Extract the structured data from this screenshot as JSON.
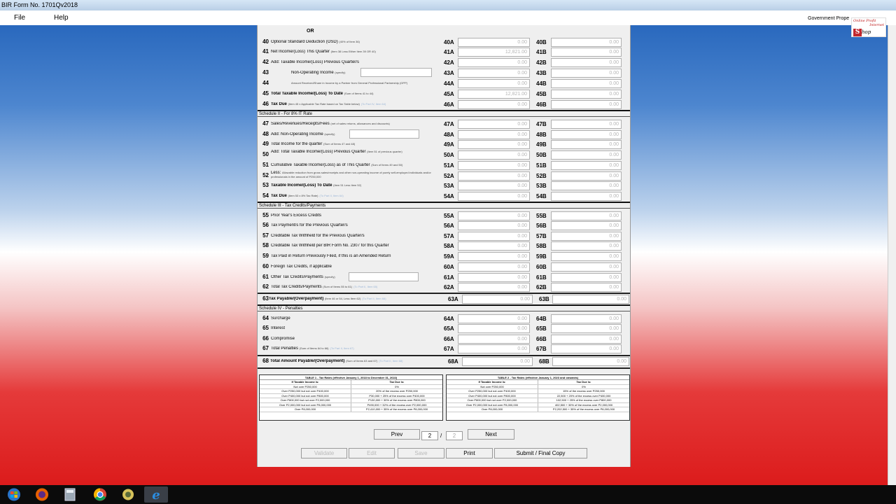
{
  "window": {
    "title": "BIR Form No. 1701Qv2018"
  },
  "menu": {
    "file": "File",
    "help": "Help",
    "gov_label": "Government Prope"
  },
  "logo": {
    "line1": "Online Profit",
    "line2": "Internet",
    "s": "S",
    "shop": "hop"
  },
  "form": {
    "or_label": "OR",
    "rows_top": [
      {
        "num": "40",
        "label": "Optional Standard Deduction (OSD)",
        "sub": "(40% of Item 36)",
        "a": "40A",
        "av": "0.00",
        "b": "40B",
        "bv": "0.00"
      },
      {
        "num": "41",
        "label": "Net Income/(Loss) This Quarter",
        "sub": "(Item 38 Less Either Item 39 OR 40)",
        "a": "41A",
        "av": "12,821.00",
        "b": "41B",
        "bv": "0.00"
      },
      {
        "num": "42",
        "pre": "Add:",
        "label": "Taxable Income/(Loss) Previous Quarter/s",
        "sub": "",
        "a": "42A",
        "av": "0.00",
        "b": "42B",
        "bv": "0.00"
      },
      {
        "num": "43",
        "label": "Non-Operating Income",
        "sub": "(specify)",
        "a": "43A",
        "av": "0.00",
        "b": "43B",
        "bv": "0.00"
      },
      {
        "num": "44",
        "label": "",
        "sub": "Amount Received/Share in Income by a Partner from General Professional Partnership (GPP)",
        "a": "44A",
        "av": "0.00",
        "b": "44B",
        "bv": "0.00"
      },
      {
        "num": "45",
        "label": "Total Taxable Income/(Loss) To Date",
        "sub": "(Sum of Items 41 to 44)",
        "a": "45A",
        "av": "12,821.00",
        "b": "45B",
        "bv": "0.00"
      },
      {
        "num": "46",
        "label": "Tax Due",
        "sub": "(Item 45 x Applicable Tax Rate based on Tax Table below)",
        "hint": "(To Part IV, Item 64)",
        "a": "46A",
        "av": "0.00",
        "b": "46B",
        "bv": "0.00"
      }
    ],
    "schedule2": "Schedule II - For 8% IT Rate",
    "rows_s2": [
      {
        "num": "47",
        "label": "Sales/Revenues/Receipts/Fees",
        "sub": "(net of sales returns, allowances and discounts)",
        "a": "47A",
        "av": "0.00",
        "b": "47B",
        "bv": "0.00"
      },
      {
        "num": "48",
        "label": "Add: Non-Operating Income",
        "sub": "(specify)",
        "a": "48A",
        "av": "0.00",
        "b": "48B",
        "bv": "0.00"
      },
      {
        "num": "49",
        "label": "Total Income for the quarter",
        "sub": "(Sum of Items 47 and 48)",
        "a": "49A",
        "av": "0.00",
        "b": "49B",
        "bv": "0.00"
      },
      {
        "num": "50",
        "label": "Add: Total Taxable Income/(Loss) Previous Quarter",
        "sub": "(Item 51 of previous quarter)",
        "a": "50A",
        "av": "0.00",
        "b": "50B",
        "bv": "0.00"
      },
      {
        "num": "51",
        "label": "Cumulative Taxable Income/(Loss) as of This Quarter",
        "sub": "(Sum of Items 49 and 50)",
        "a": "51A",
        "av": "0.00",
        "b": "51B",
        "bv": "0.00"
      },
      {
        "num": "52",
        "label": "Less:",
        "sub": "Allowable reduction from gross sales/receipts and other non-operating income of purely self-employed individuals and/or professionals in the amount of P250,000",
        "a": "52A",
        "av": "0.00",
        "b": "52B",
        "bv": "0.00"
      },
      {
        "num": "53",
        "label": "Taxable Income/(Loss) To Date",
        "sub": "(Item 51 Less Item 52)",
        "a": "53A",
        "av": "0.00",
        "b": "53B",
        "bv": "0.00"
      },
      {
        "num": "54",
        "label": "Tax Due",
        "sub": "(Item 53 x 8% Tax Rate)",
        "hint": "(To Part II, Item 64)",
        "a": "54A",
        "av": "0.00",
        "b": "54B",
        "bv": "0.00"
      }
    ],
    "schedule3": "Schedule III - Tax Credits/Payments",
    "rows_s3": [
      {
        "num": "55",
        "label": "Prior Year's Excess Credits",
        "sub": "",
        "a": "55A",
        "av": "0.00",
        "b": "55B",
        "bv": "0.00"
      },
      {
        "num": "56",
        "label": "Tax Payment/s for the Previous Quarter/s",
        "sub": "",
        "a": "56A",
        "av": "0.00",
        "b": "56B",
        "bv": "0.00"
      },
      {
        "num": "57",
        "label": "Creditable Tax Withheld for the Previous Quarter/s",
        "sub": "",
        "a": "57A",
        "av": "0.00",
        "b": "57B",
        "bv": "0.00"
      },
      {
        "num": "58",
        "label": "Creditable Tax Withheld per BIR Form No. 2307 for this Quarter",
        "sub": "",
        "a": "58A",
        "av": "0.00",
        "b": "58B",
        "bv": "0.00"
      },
      {
        "num": "59",
        "label": "Tax Paid in Return Previously Filed, if this is an Amended Return",
        "sub": "",
        "a": "59A",
        "av": "0.00",
        "b": "59B",
        "bv": "0.00"
      },
      {
        "num": "60",
        "label": "Foreign Tax Credits, if applicable",
        "sub": "",
        "a": "60A",
        "av": "0.00",
        "b": "60B",
        "bv": "0.00"
      },
      {
        "num": "61",
        "label": "Other Tax Credits/Payments",
        "sub": "(specify)",
        "a": "61A",
        "av": "0.00",
        "b": "61B",
        "bv": "0.00"
      },
      {
        "num": "62",
        "label": "Total Tax Credits/Payments",
        "sub": "(Sum of Items 55 to 61)",
        "hint": "(To Part II, Item 65)",
        "a": "62A",
        "av": "0.00",
        "b": "62B",
        "bv": "0.00"
      }
    ],
    "row63": {
      "num": "63",
      "label": "Tax Payable/(Overpayment)",
      "sub": "(Item 46 or 54, Less Item 62)",
      "hint": "(To Part II, Item 66)",
      "a": "63A",
      "av": "0.00",
      "b": "63B",
      "bv": "0.00"
    },
    "schedule4": "Schedule IV - Penalties",
    "rows_s4": [
      {
        "num": "64",
        "label": "Surcharge",
        "sub": "",
        "a": "64A",
        "av": "0.00",
        "b": "64B",
        "bv": "0.00"
      },
      {
        "num": "65",
        "label": "Interest",
        "sub": "",
        "a": "65A",
        "av": "0.00",
        "b": "65B",
        "bv": "0.00"
      },
      {
        "num": "66",
        "label": "Compromise",
        "sub": "",
        "a": "66A",
        "av": "0.00",
        "b": "66B",
        "bv": "0.00"
      },
      {
        "num": "67",
        "label": "Total Penalties",
        "sub": "(Sum of Items 64 to 66)",
        "hint": "(To Part II, Item 67)",
        "a": "67A",
        "av": "0.00",
        "b": "67B",
        "bv": "0.00"
      }
    ],
    "row68": {
      "num": "68",
      "label": "Total Amount Payable/(Overpayment)",
      "sub": "(Sum of Items 63 and 67)",
      "hint": "(To Part II, Item 68)",
      "a": "68A",
      "av": "0.00",
      "b": "68B",
      "bv": "0.00"
    }
  },
  "table1": {
    "title": "TABLE 1 - Tax Rates (effective January 1, 2018 to December 31, 2022)",
    "h1": "If Taxable Income is:",
    "h2": "Tax Due is:",
    "rows": [
      [
        "Not over P250,000",
        "0%"
      ],
      [
        "Over P250,000 but not over P400,000",
        "20% of the excess over P250,000"
      ],
      [
        "Over P400,000 but not over P800,000",
        "P30,000 + 25% of the excess over P400,000"
      ],
      [
        "Over P800,000 but not over P2,000,000",
        "P130,000 + 30% of the excess over P800,000"
      ],
      [
        "Over P2,000,000 but not over P8,000,000",
        "P490,000 + 32% of the excess over P2,000,000"
      ],
      [
        "Over P8,000,000",
        "P2,410,000 + 35% of the excess over P8,000,000"
      ]
    ]
  },
  "table2": {
    "title": "TABLE 2 - Tax Rates (effective January 1, 2023 and onwards)",
    "h1": "If Taxable Income is:",
    "h2": "Tax Due is:",
    "rows": [
      [
        "Not over P250,000",
        "0%"
      ],
      [
        "Over P250,000 but not over P400,000",
        "15% of the excess over P250,000"
      ],
      [
        "Over P400,000 but not over P800,000",
        "22,500 + 20% of the excess over P400,000"
      ],
      [
        "Over P800,000 but not over P2,000,000",
        "102,500 + 25% of the excess over P800,000"
      ],
      [
        "Over P2,000,000 but not over P8,000,000",
        "402,500 + 30% of the excess over P2,000,000"
      ],
      [
        "Over P8,000,000",
        "P2,202,500 + 35% of the excess over P8,000,000"
      ]
    ]
  },
  "nav": {
    "prev": "Prev",
    "page": "2",
    "slash": "/",
    "total": "2",
    "next": "Next"
  },
  "actions": {
    "validate": "Validate",
    "edit": "Edit",
    "save": "Save",
    "print": "Print",
    "submit": "Submit / Final Copy"
  },
  "taskbar": {
    "items": [
      "start-orb-icon",
      "firefox-icon",
      "calculator-icon",
      "chrome-icon",
      "app-icon",
      "internet-explorer-icon"
    ]
  },
  "colors": {
    "accent_blue": "#1e5fb8",
    "accent_red": "#dc1c1c",
    "field_text": "#b5b5b5"
  }
}
